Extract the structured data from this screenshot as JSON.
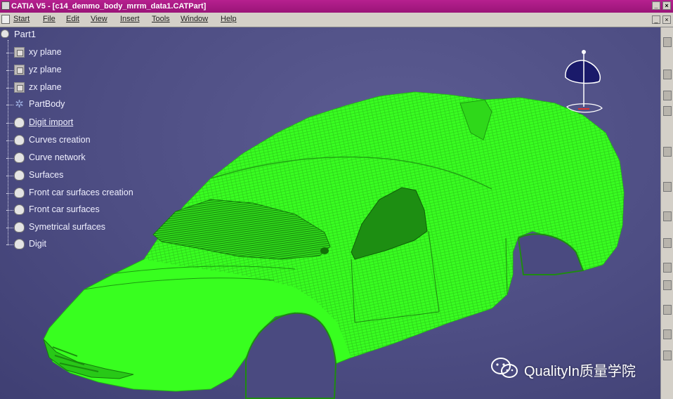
{
  "titlebar": {
    "title": "CATIA V5 - [c14_demmo_body_mrrm_data1.CATPart]"
  },
  "menubar": {
    "items": [
      "Start",
      "File",
      "Edit",
      "View",
      "Insert",
      "Tools",
      "Window",
      "Help"
    ]
  },
  "tree": {
    "root": "Part1",
    "nodes": [
      {
        "label": "xy plane",
        "icon": "plane-icon"
      },
      {
        "label": "yz plane",
        "icon": "plane-icon"
      },
      {
        "label": "zx plane",
        "icon": "plane-icon"
      },
      {
        "label": "PartBody",
        "icon": "partbody-icon"
      },
      {
        "label": "Digit import",
        "icon": "geometrical-set-icon"
      },
      {
        "label": "Curves creation",
        "icon": "geometrical-set-icon"
      },
      {
        "label": "Curve network",
        "icon": "geometrical-set-icon"
      },
      {
        "label": "Surfaces",
        "icon": "geometrical-set-icon"
      },
      {
        "label": "Front car surfaces creation",
        "icon": "geometrical-set-icon"
      },
      {
        "label": "Front car surfaces",
        "icon": "geometrical-set-icon"
      },
      {
        "label": "Symetrical surfaces",
        "icon": "geometrical-set-icon"
      },
      {
        "label": "Digit",
        "icon": "geometrical-set-icon"
      }
    ]
  },
  "watermark": {
    "brand": "QualityIn质量学院"
  },
  "colors": {
    "titlebar": "#a3177f",
    "viewport": "#4d4d83",
    "model": "#33ff1c",
    "mesh": "#1f8a12",
    "tree_text": "#f0f0ff"
  }
}
